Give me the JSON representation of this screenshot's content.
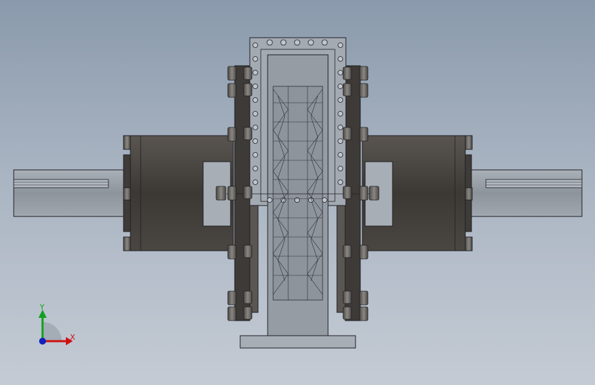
{
  "viewport": {
    "background_top": "#8a9aac",
    "background_bottom": "#c4cbd4"
  },
  "model": {
    "view": "front",
    "shaft_color": "#9aa1a9",
    "hub_color": "#4a4642",
    "flange_color": "#3c3a38",
    "bolt_color": "#6f6b67",
    "housing_color": "#99a0a8",
    "line_color": "#1f1f22"
  },
  "triad": {
    "x_label": "X",
    "y_label": "Y",
    "x_color": "#d01010",
    "y_color": "#10a020",
    "z_color": "#1020c0"
  }
}
